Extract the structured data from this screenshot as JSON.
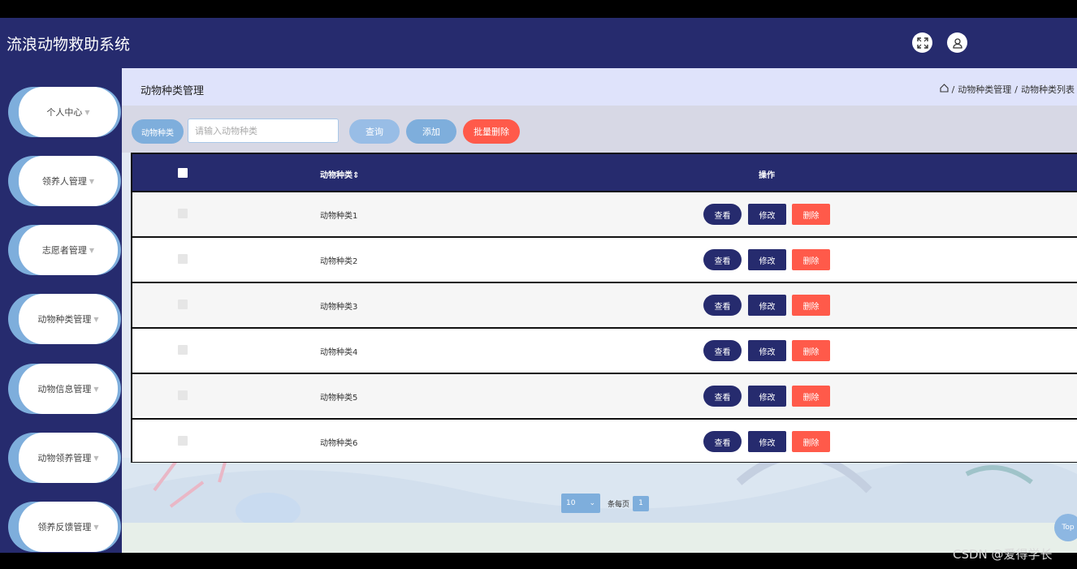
{
  "app": {
    "title": "流浪动物救助系统"
  },
  "topbar": {
    "fullscreen_icon": "fullscreen-icon",
    "user_icon": "user-icon"
  },
  "sidebar": {
    "items": [
      {
        "label": "个人中心"
      },
      {
        "label": "领养人管理"
      },
      {
        "label": "志愿者管理"
      },
      {
        "label": "动物种类管理"
      },
      {
        "label": "动物信息管理"
      },
      {
        "label": "动物领养管理"
      },
      {
        "label": "领养反馈管理"
      }
    ]
  },
  "page": {
    "title": "动物种类管理",
    "breadcrumb": {
      "sep": "/",
      "level1": "动物种类管理",
      "level2": "动物种类列表"
    }
  },
  "search": {
    "label": "动物种类",
    "placeholder": "请输入动物种类",
    "query_label": "查询",
    "add_label": "添加",
    "batch_delete_label": "批量删除"
  },
  "table": {
    "columns": {
      "name": "动物种类",
      "sort_icon": "sort-icon",
      "actions": "操作"
    },
    "rows": [
      {
        "name": "动物种类1"
      },
      {
        "name": "动物种类2"
      },
      {
        "name": "动物种类3"
      },
      {
        "name": "动物种类4"
      },
      {
        "name": "动物种类5"
      },
      {
        "name": "动物种类6"
      }
    ],
    "actions": {
      "view": "查看",
      "edit": "修改",
      "delete": "删除"
    }
  },
  "pagination": {
    "page_size": "10",
    "per_page_text": "条每页",
    "current_page": "1"
  },
  "top_button": "Top",
  "watermark": "CSDN @爱得学长",
  "colors": {
    "primary": "#262b6e",
    "accent": "#7eaedc",
    "danger": "#ff5a4a"
  }
}
